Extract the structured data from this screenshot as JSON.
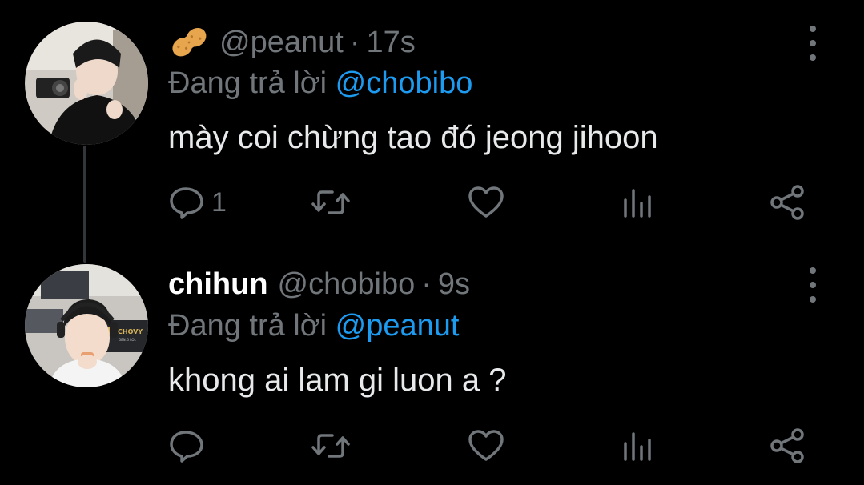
{
  "tweets": [
    {
      "emoji": "peanut",
      "display_name": "",
      "handle": "@peanut",
      "separator": "·",
      "time": "17s",
      "reply_label": "Đang trả lời",
      "reply_to": "@chobibo",
      "text": "mày coi chừng tao đó jeong jihoon",
      "reply_count": "1",
      "avatar": "avatar-photo-man-with-camera"
    },
    {
      "emoji": "",
      "display_name": "chihun",
      "handle": "@chobibo",
      "separator": "·",
      "time": "9s",
      "reply_label": "Đang trả lời",
      "reply_to": "@peanut",
      "text": "khong ai lam gi luon a ?",
      "reply_count": "",
      "avatar": "avatar-photo-player-chovy"
    }
  ],
  "avatar_overlay": {
    "badge_text": "CHOVY",
    "badge_sub": "GEN.G LOL"
  },
  "icons": {
    "reply": "reply-icon",
    "retweet": "retweet-icon",
    "like": "like-icon",
    "views": "views-icon",
    "share": "share-icon",
    "more": "more-icon"
  },
  "colors": {
    "background": "#000000",
    "text": "#e7e9ea",
    "muted": "#71767b",
    "accent": "#1d9bf0",
    "thread_line": "#333639"
  }
}
